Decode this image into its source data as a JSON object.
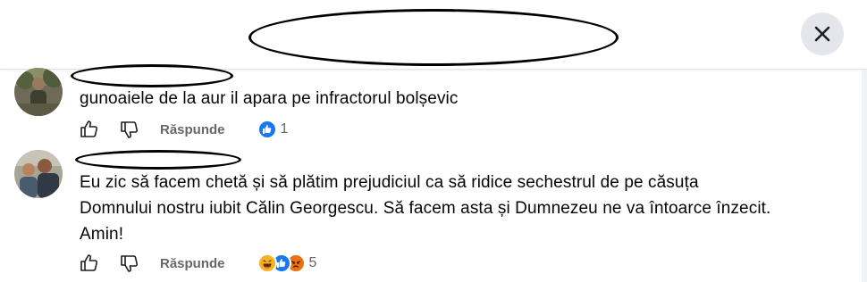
{
  "header": {
    "close_icon": "close-icon"
  },
  "comments": [
    {
      "text": "gunoaiele de la aur il apara pe infractorul bolșevic",
      "reply_label": "Răspunde",
      "reaction_count": "1",
      "reactions": [
        "like"
      ]
    },
    {
      "text_lines": [
        "Eu zic să facem chetă și să plătim prejudiciul ca să ridice sechestrul de pe căsuța",
        "Domnului nostru iubit Călin Georgescu. Să facem asta și Dumnezeu ne va întoarce înzecit.",
        "Amin!"
      ],
      "reply_label": "Răspunde",
      "reaction_count": "5",
      "reactions": [
        "haha",
        "like",
        "angry"
      ]
    }
  ],
  "colors": {
    "like_blue": "#1877f2",
    "muted_text": "#65676b",
    "haha_yellow": "#f7b125",
    "angry_red": "#e9710f"
  }
}
